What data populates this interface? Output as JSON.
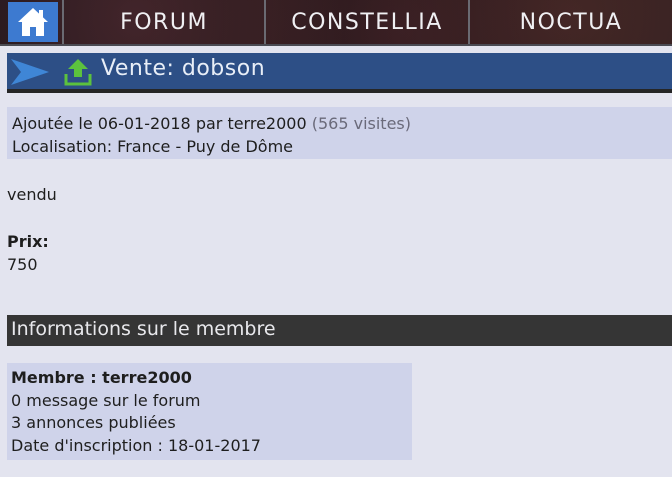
{
  "nav": {
    "home_icon": "home-icon",
    "tabs": [
      {
        "label": "FORUM"
      },
      {
        "label": "CONSTELLIA"
      },
      {
        "label": "NOCTUA"
      }
    ]
  },
  "listing": {
    "title": "Vente: dobson",
    "added_text": "Ajoutée le 06-01-2018 par terre2000",
    "visits": "(565 visites)",
    "location": "Localisation: France - Puy de Dôme",
    "description": "vendu",
    "price_label": "Prix:",
    "price_value": "750"
  },
  "member": {
    "section_title": "Informations sur le membre",
    "name_line": "Membre : terre2000",
    "messages": "0 message sur le forum",
    "announcements": "3 annonces publiées",
    "signup": "Date d'inscription : 18-01-2017"
  },
  "colors": {
    "accent_blue": "#3d7ad0",
    "title_bar": "#2d4f86",
    "info_bg": "#cfd3ea",
    "section_header": "#353535"
  }
}
